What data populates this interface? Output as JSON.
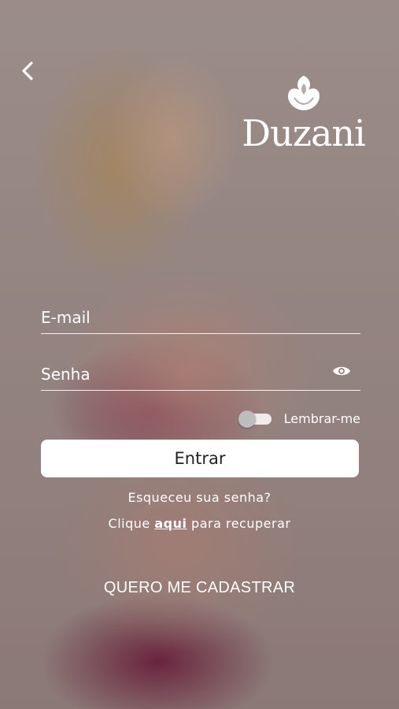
{
  "brand": {
    "name": "Duzani"
  },
  "login": {
    "email_placeholder": "E-mail",
    "password_placeholder": "Senha",
    "remember_label": "Lembrar-me",
    "remember_on": false,
    "enter_label": "Entrar",
    "forgot_text": "Esqueceu sua senha?",
    "recover_prefix": "Clique",
    "recover_link": "aqui",
    "recover_suffix": "para recuperar",
    "register_label": "QUERO ME CADASTRAR"
  },
  "icons": {
    "back": "chevron-left-icon",
    "logo": "rose-icon",
    "eye": "eye-icon"
  },
  "colors": {
    "text": "#ffffff",
    "button_bg": "#ffffff",
    "button_text": "#222222",
    "toggle_knob": "#bdbdbd"
  }
}
